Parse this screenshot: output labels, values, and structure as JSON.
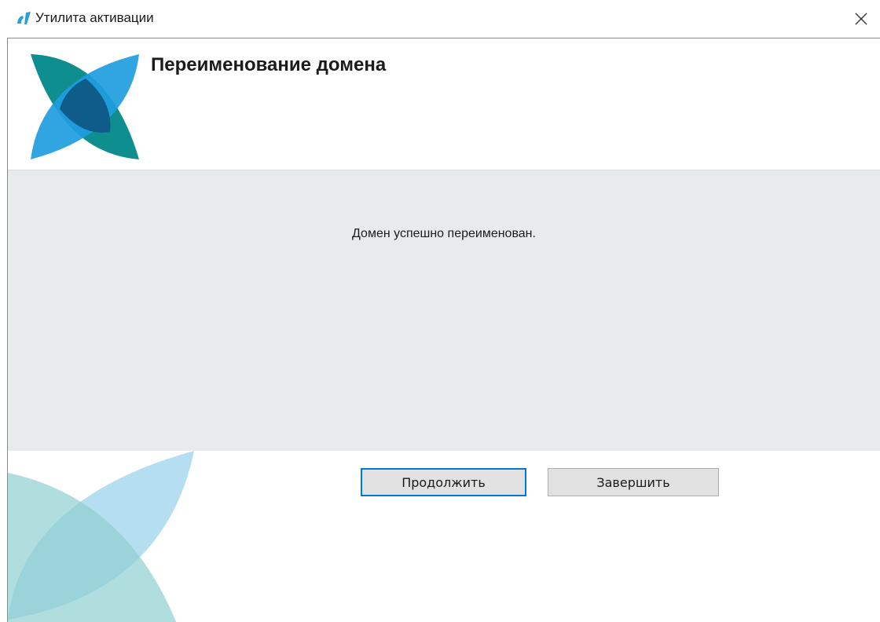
{
  "window": {
    "title": "Утилита активации",
    "app_icon": "ci-logo-icon",
    "close_icon": "close-icon"
  },
  "header": {
    "title": "Переименование домена",
    "logo": "four-petal-logo-icon"
  },
  "content": {
    "message": "Домен успешно переименован."
  },
  "buttons": {
    "continue_label": "Продолжить",
    "finish_label": "Завершить"
  },
  "colors": {
    "teal": "#0e8e8e",
    "blue": "#1f9de0",
    "dark_blue": "#0f5b8a",
    "content_bg": "#e8ebec",
    "focus_border": "#0078d7"
  }
}
